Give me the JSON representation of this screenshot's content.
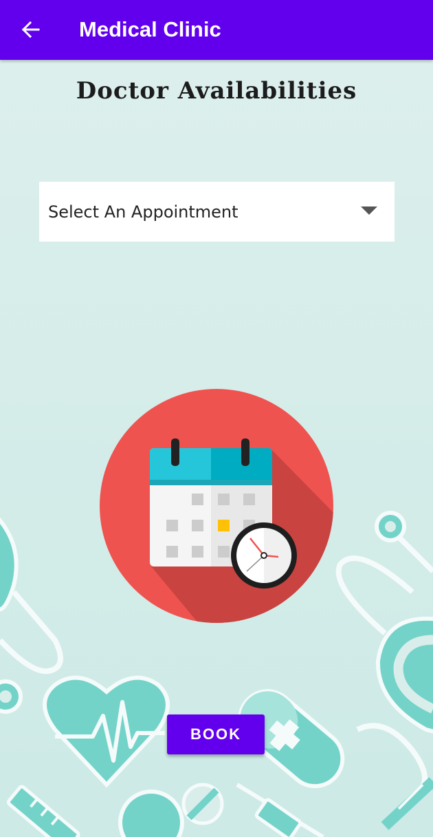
{
  "app_bar": {
    "title": "Medical Clinic",
    "back_icon": "arrow-left-icon",
    "color": "#6200ee"
  },
  "heading": "Doctor Availabilities",
  "appointment_select": {
    "selected": "Select An Appointment",
    "caret_icon": "triangle-down-icon"
  },
  "illustration": {
    "icon": "calendar-clock-icon",
    "circle_color": "#ef5350"
  },
  "book_button": {
    "label": "BOOK",
    "color": "#6200ee"
  },
  "colors": {
    "background": "#d9eeeb",
    "decor_teal": "#74d3c9"
  }
}
